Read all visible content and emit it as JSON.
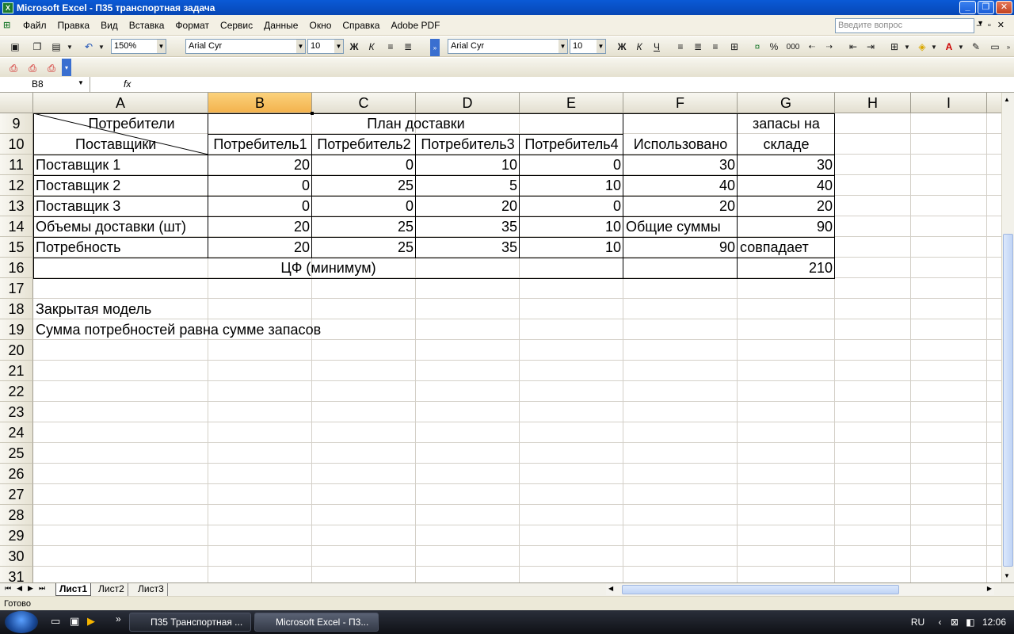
{
  "window": {
    "title": "Microsoft Excel - П35 транспортная задача"
  },
  "menu": {
    "items": [
      "Файл",
      "Правка",
      "Вид",
      "Вставка",
      "Формат",
      "Сервис",
      "Данные",
      "Окно",
      "Справка",
      "Adobe PDF"
    ],
    "ask_placeholder": "Введите вопрос"
  },
  "toolbar": {
    "zoom": "150%",
    "font1": "Arial Cyr",
    "size1": "10",
    "font2": "Arial Cyr",
    "size2": "10",
    "bold": "Ж",
    "italic": "К",
    "underline": "Ч",
    "percent": "%",
    "thousands": "000"
  },
  "formula_bar": {
    "name_box": "B8",
    "fx": "fx",
    "content": ""
  },
  "columns": [
    "A",
    "B",
    "C",
    "D",
    "E",
    "F",
    "G",
    "H",
    "I"
  ],
  "selected_column": "B",
  "rows": [
    "9",
    "10",
    "11",
    "12",
    "13",
    "14",
    "15",
    "16",
    "17",
    "18",
    "19",
    "20",
    "21",
    "22",
    "23",
    "24",
    "25",
    "26",
    "27",
    "28",
    "29",
    "30",
    "31"
  ],
  "table": {
    "consumers_label": "Потребители",
    "suppliers_label": "Поставщики",
    "plan_header": "План доставки",
    "stock_header_1": "запасы на",
    "stock_header_2": "складе",
    "consumer_headers": [
      "Потребитель1",
      "Потребитель2",
      "Потребитель3",
      "Потребитель4"
    ],
    "used_header": "Использовано",
    "body": [
      {
        "label": "Поставщик 1",
        "values": [
          "20",
          "0",
          "10",
          "0"
        ],
        "used": "30",
        "stock": "30"
      },
      {
        "label": "Поставщик 2",
        "values": [
          "0",
          "25",
          "5",
          "10"
        ],
        "used": "40",
        "stock": "40"
      },
      {
        "label": "Поставщик 3",
        "values": [
          "0",
          "0",
          "20",
          "0"
        ],
        "used": "20",
        "stock": "20"
      },
      {
        "label": "Объемы доставки (шт)",
        "values": [
          "20",
          "25",
          "35",
          "10"
        ],
        "used": "Общие суммы",
        "stock": "90"
      },
      {
        "label": "Потребность",
        "values": [
          "20",
          "25",
          "35",
          "10"
        ],
        "used": "90",
        "stock": "совпадает"
      }
    ],
    "objective_label": "ЦФ (минимум)",
    "objective_value": "210",
    "note_1": "Закрытая модель",
    "note_2": "Сумма потребностей равна сумме запасов"
  },
  "sheets": [
    "Лист1",
    "Лист2",
    "Лист3"
  ],
  "active_sheet": "Лист1",
  "status": "Готово",
  "taskbar": {
    "tasks": [
      "П35 Транспортная ...",
      "Microsoft Excel - П3..."
    ],
    "lang": "RU",
    "clock": "12:06"
  }
}
